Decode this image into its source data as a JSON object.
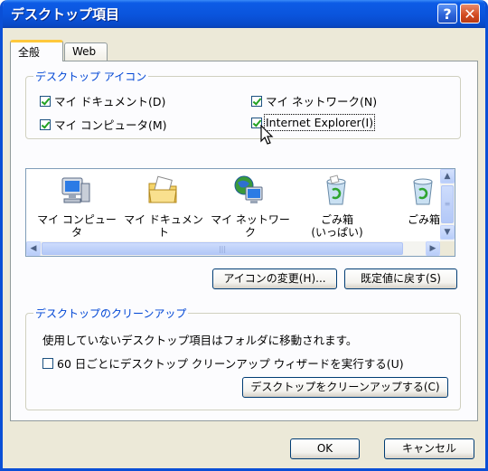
{
  "window": {
    "title": "デスクトップ項目"
  },
  "tabs": [
    {
      "label": "全般"
    },
    {
      "label": "Web"
    }
  ],
  "desktop_icons_group": {
    "title": "デスクトップ アイコン",
    "checkboxes": [
      {
        "label": "マイ ドキュメント(D)",
        "checked": true
      },
      {
        "label": "マイ ネットワーク(N)",
        "checked": true
      },
      {
        "label": "マイ コンピュータ(M)",
        "checked": true
      },
      {
        "label": "Internet Explorer(I)",
        "checked": true
      }
    ]
  },
  "icon_list": {
    "items": [
      {
        "label": "マイ コンピュータ",
        "icon": "my-computer-icon"
      },
      {
        "label": "マイ ドキュメント",
        "icon": "my-documents-icon"
      },
      {
        "label": "マイ ネットワーク",
        "icon": "my-network-icon"
      },
      {
        "label": "ごみ箱\n(いっぱい)",
        "icon": "recycle-bin-full-icon"
      },
      {
        "label": "ごみ箱",
        "icon": "recycle-bin-icon"
      }
    ]
  },
  "buttons": {
    "change_icon": "アイコンの変更(H)...",
    "restore_default": "既定値に戻す(S)",
    "ok": "OK",
    "cancel": "キャンセル",
    "cleanup_now": "デスクトップをクリーンアップする(C)"
  },
  "cleanup_group": {
    "title": "デスクトップのクリーンアップ",
    "description": "使用していないデスクトップ項目はフォルダに移動されます。",
    "checkbox_label": "60 日ごとにデスクトップ クリーンアップ ウィザードを実行する(U)",
    "checkbox_checked": false
  },
  "colors": {
    "titlebar": "#0a54dc",
    "group_title": "#0046d5",
    "dialog_bg": "#ece9d8"
  }
}
